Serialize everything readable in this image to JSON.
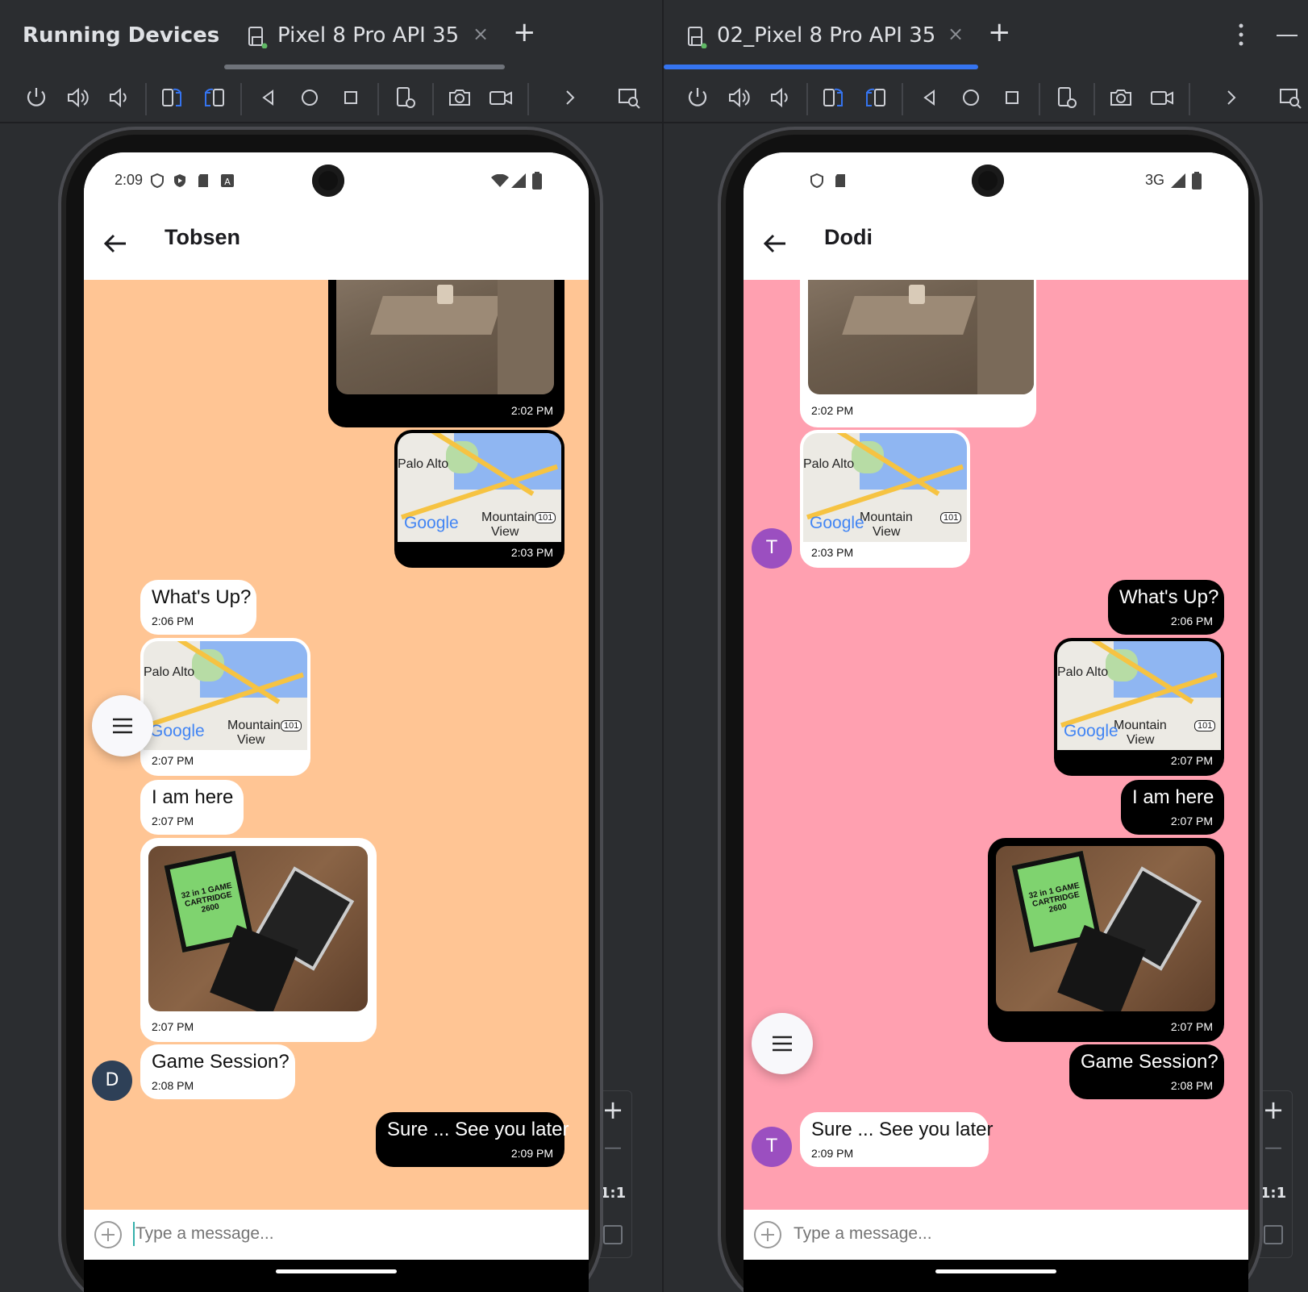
{
  "left": {
    "panel_title": "Running Devices",
    "tab_label": "Pixel 8 Pro API 35",
    "tab_close": "×",
    "tab_add": "+",
    "statusbar": {
      "time": "2:09"
    },
    "contact_name": "Tobsen",
    "chat_bg": "#ffc594",
    "messages": [
      {
        "time": "2:02 PM"
      },
      {
        "map_label_1": "Palo Alto",
        "map_label_2": "Mountain",
        "map_label_3": "View",
        "map_brand": "Google",
        "map_route": "101",
        "time": "2:03 PM"
      },
      {
        "text": "What's Up?",
        "time": "2:06 PM"
      },
      {
        "map_label_1": "Palo Alto",
        "map_label_2": "Mountain",
        "map_label_3": "View",
        "map_brand": "Google",
        "map_route": "101",
        "time": "2:07 PM"
      },
      {
        "text": "I am here",
        "time": "2:07 PM"
      },
      {
        "time": "2:07 PM"
      },
      {
        "text": "Game Session?",
        "time": "2:08 PM"
      },
      {
        "text": "Sure ... See you later",
        "time": "2:09 PM"
      }
    ],
    "avatar_letter": "D",
    "input_placeholder": "Type a message...",
    "zoom_in": "+",
    "zoom_out": "—",
    "zoom_actual": "1:1"
  },
  "right": {
    "tab_label": "02_Pixel 8 Pro API 35",
    "tab_close": "×",
    "tab_add": "+",
    "statusbar": {
      "network": "3G"
    },
    "contact_name": "Dodi",
    "chat_bg": "#ffa0b0",
    "messages": [
      {
        "time": "2:02 PM"
      },
      {
        "map_label_1": "Palo Alto",
        "map_label_2": "Mountain",
        "map_label_3": "View",
        "map_brand": "Google",
        "map_route": "101",
        "time": "2:03 PM"
      },
      {
        "text": "What's Up?",
        "time": "2:06 PM"
      },
      {
        "map_label_1": "Palo Alto",
        "map_label_2": "Mountain",
        "map_label_3": "View",
        "map_brand": "Google",
        "map_route": "101",
        "time": "2:07 PM"
      },
      {
        "text": "I am here",
        "time": "2:07 PM"
      },
      {
        "time": "2:07 PM"
      },
      {
        "text": "Game Session?",
        "time": "2:08 PM"
      },
      {
        "text": "Sure ... See you later",
        "time": "2:09 PM"
      }
    ],
    "avatar_letter": "T",
    "input_placeholder": "Type a message...",
    "zoom_in": "+",
    "zoom_out": "—",
    "zoom_actual": "1:1"
  },
  "colors": {
    "ide_bg": "#2b2d30",
    "active_tab": "#3574f0",
    "inactive_tab": "#6f737a",
    "avatar_dark": "#2e4057",
    "avatar_purple": "#9b4fc0"
  },
  "cartridge_labels": {
    "a": "32 in 1 GAME",
    "b": "CARTRIDGE",
    "c": "2600"
  }
}
